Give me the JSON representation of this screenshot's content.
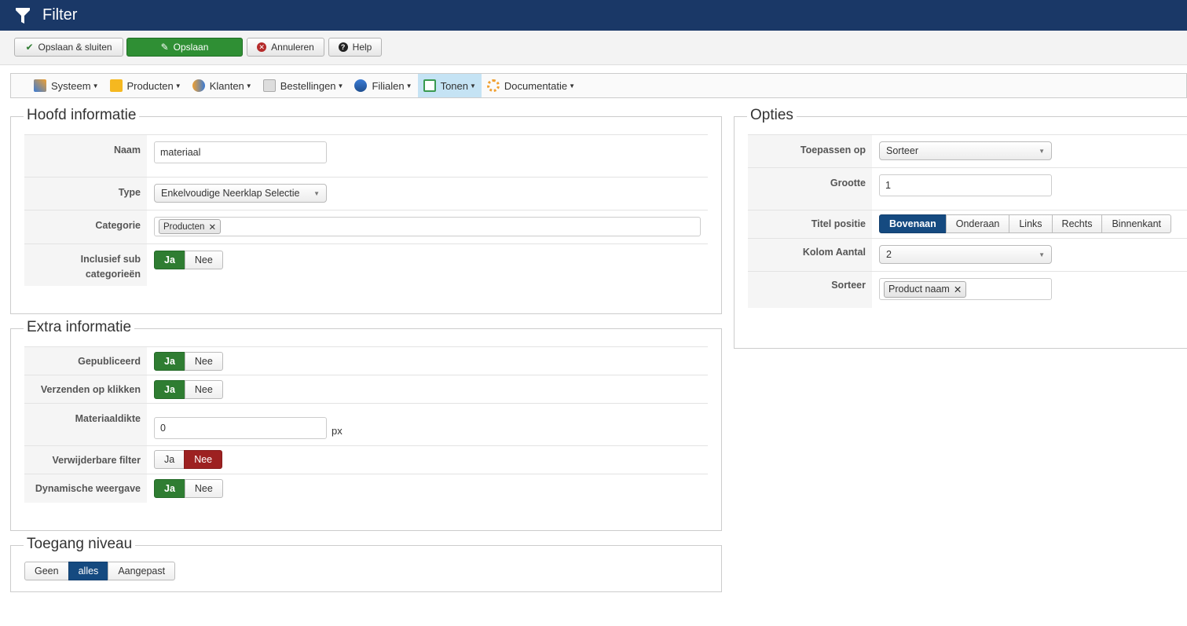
{
  "header": {
    "title": "Filter",
    "icon": "filter-icon"
  },
  "toolbar": {
    "save_close": "Opslaan & sluiten",
    "save": "Opslaan",
    "cancel": "Annuleren",
    "help": "Help"
  },
  "nav": {
    "items": [
      {
        "label": "Systeem",
        "icon": "tools-icon"
      },
      {
        "label": "Producten",
        "icon": "box-icon"
      },
      {
        "label": "Klanten",
        "icon": "users-icon"
      },
      {
        "label": "Bestellingen",
        "icon": "orders-icon"
      },
      {
        "label": "Filialen",
        "icon": "stores-icon"
      },
      {
        "label": "Tonen",
        "icon": "display-icon",
        "active": true
      },
      {
        "label": "Documentatie",
        "icon": "help-ring-icon"
      }
    ]
  },
  "main": {
    "legend": "Hoofd informatie",
    "naam_label": "Naam",
    "naam_value": "materiaal",
    "type_label": "Type",
    "type_value": "Enkelvoudige Neerklap Selectie",
    "categorie_label": "Categorie",
    "categorie_tag": "Producten",
    "sub_label": "Inclusief sub categorieën",
    "yes": "Ja",
    "no": "Nee"
  },
  "extra": {
    "legend": "Extra informatie",
    "gepubliceerd": "Gepubliceerd",
    "verzenden": "Verzenden op klikken",
    "dikte_label": "Materiaaldikte",
    "dikte_value": "0",
    "dikte_unit": "px",
    "verwijderbaar": "Verwijderbare filter",
    "dynamisch": "Dynamische weergave"
  },
  "access": {
    "legend": "Toegang niveau",
    "options": [
      "Geen",
      "alles",
      "Aangepast"
    ],
    "selected": "alles"
  },
  "options": {
    "legend": "Opties",
    "toepassen_label": "Toepassen op",
    "toepassen_value": "Sorteer",
    "grootte_label": "Grootte",
    "grootte_value": "1",
    "titel_label": "Titel positie",
    "titel_options": [
      "Bovenaan",
      "Onderaan",
      "Links",
      "Rechts",
      "Binnenkant"
    ],
    "titel_selected": "Bovenaan",
    "kolom_label": "Kolom Aantal",
    "kolom_value": "2",
    "sorteer_label": "Sorteer",
    "sorteer_tag": "Product naam"
  },
  "colors": {
    "header": "#1a3867",
    "green": "#2f7d32",
    "red": "#9d2121",
    "blue": "#154a80"
  }
}
